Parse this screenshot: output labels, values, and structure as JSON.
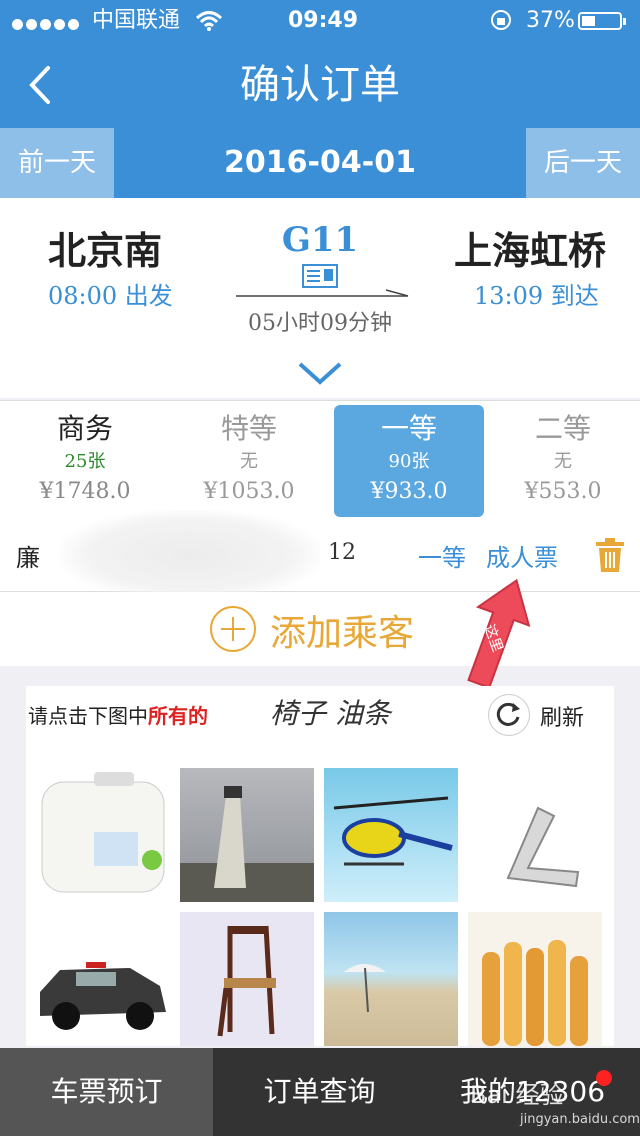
{
  "status": {
    "carrier": "中国联通",
    "time": "09:49",
    "battery": "37%"
  },
  "header": {
    "title": "确认订单"
  },
  "date_bar": {
    "prev": "前一天",
    "date": "2016-04-01",
    "next": "后一天"
  },
  "train": {
    "from": "北京南",
    "depart": "08:00 出发",
    "number": "G11",
    "duration": "05小时09分钟",
    "to": "上海虹桥",
    "arrive": "13:09 到达"
  },
  "seats": [
    {
      "name": "商务",
      "count": "25张",
      "price": "¥1748.0"
    },
    {
      "name": "特等",
      "count": "无",
      "price": "¥1053.0"
    },
    {
      "name": "一等",
      "count": "90张",
      "price": "¥933.0"
    },
    {
      "name": "二等",
      "count": "无",
      "price": "¥553.0"
    }
  ],
  "passenger": {
    "name": "廉",
    "id_tail": "12",
    "seat": "一等",
    "type": "成人票"
  },
  "add_passenger": "添加乘客",
  "annotation": "这里",
  "captcha": {
    "prompt_prefix": "请点击下图中",
    "prompt_emph": "所有的",
    "target": "椅子 油条",
    "refresh": "刷新"
  },
  "tabs": [
    "车票预订",
    "订单查询",
    "我的12306"
  ],
  "watermark": {
    "main": "Bai 经验",
    "url": "jingyan.baidu.com"
  },
  "colors": {
    "primary": "#3a8fd6",
    "accent": "#e8a838",
    "selected_seat": "#5ba7e0",
    "tabbar": "#333333"
  }
}
